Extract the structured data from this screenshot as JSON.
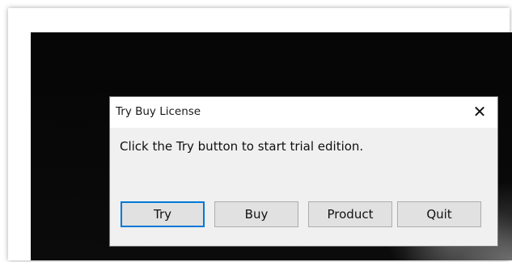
{
  "dialog": {
    "title": "Try Buy License",
    "close_glyph": "✕",
    "message": "Click the Try button to start trial edition.",
    "buttons": {
      "try": "Try",
      "buy": "Buy",
      "product": "Product",
      "quit": "Quit"
    }
  },
  "colors": {
    "focus_border": "#0078d7",
    "dialog_bg": "#f0f0f0"
  },
  "icons": {
    "close": "close-icon"
  }
}
